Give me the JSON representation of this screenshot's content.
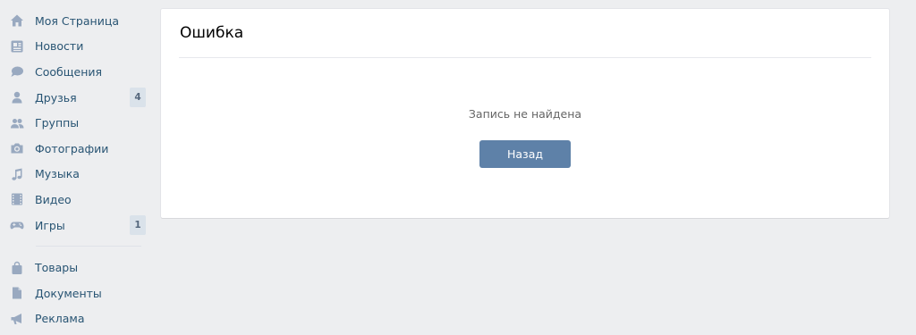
{
  "sidebar": {
    "items": [
      {
        "label": "Моя Страница",
        "icon": "home-icon"
      },
      {
        "label": "Новости",
        "icon": "news-icon"
      },
      {
        "label": "Сообщения",
        "icon": "messages-icon"
      },
      {
        "label": "Друзья",
        "icon": "user-icon",
        "count": "4"
      },
      {
        "label": "Группы",
        "icon": "groups-icon"
      },
      {
        "label": "Фотографии",
        "icon": "camera-icon"
      },
      {
        "label": "Музыка",
        "icon": "music-icon"
      },
      {
        "label": "Видео",
        "icon": "video-icon"
      },
      {
        "label": "Игры",
        "icon": "gamepad-icon",
        "count": "1"
      }
    ],
    "extra_items": [
      {
        "label": "Товары",
        "icon": "bag-icon"
      },
      {
        "label": "Документы",
        "icon": "document-icon"
      },
      {
        "label": "Реклама",
        "icon": "megaphone-icon"
      }
    ]
  },
  "error_card": {
    "title": "Ошибка",
    "message": "Запись не найдена",
    "back_label": "Назад"
  },
  "colors": {
    "background": "#edeef0",
    "link": "#285473",
    "icon": "#99a9c0",
    "button": "#5e81a8",
    "badge": "#dae2ea"
  }
}
